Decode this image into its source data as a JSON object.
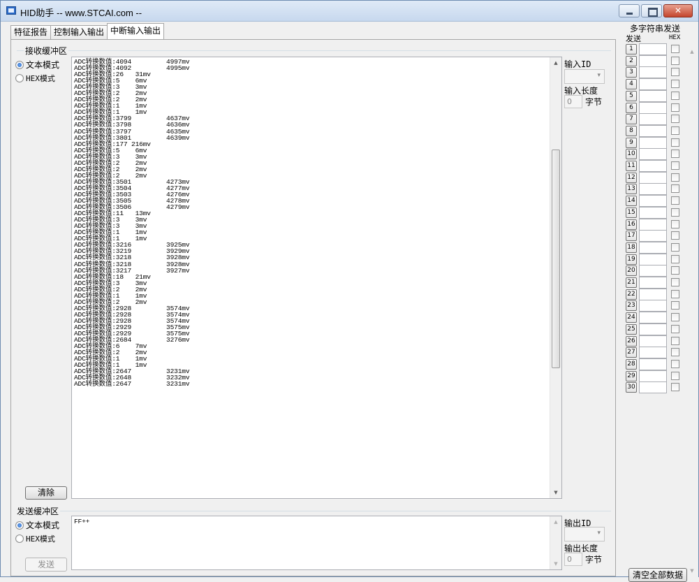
{
  "window": {
    "title": "HID助手 -- www.STCAI.com --"
  },
  "tabs": [
    {
      "label": "特征报告"
    },
    {
      "label": "控制输入输出"
    },
    {
      "label": "中断输入输出"
    }
  ],
  "receive": {
    "group_label": "接收缓冲区",
    "mode_text": "文本模式",
    "mode_hex": "HEX模式",
    "clear_button": "清除",
    "lines": [
      "ADC转换数值:4094         4997mv",
      "ADC转换数值:4092         4995mv",
      "ADC转换数值:26   31mv",
      "ADC转换数值:5    6mv",
      "ADC转换数值:3    3mv",
      "ADC转换数值:2    2mv",
      "ADC转换数值:2    2mv",
      "ADC转换数值:1    1mv",
      "ADC转换数值:1    1mv",
      "ADC转换数值:3799         4637mv",
      "ADC转换数值:3798         4636mv",
      "ADC转换数值:3797         4635mv",
      "ADC转换数值:3801         4639mv",
      "ADC转换数值:177 216mv",
      "ADC转换数值:5    6mv",
      "ADC转换数值:3    3mv",
      "ADC转换数值:2    2mv",
      "ADC转换数值:2    2mv",
      "ADC转换数值:2    2mv",
      "ADC转换数值:3501         4273mv",
      "ADC转换数值:3504         4277mv",
      "ADC转换数值:3503         4276mv",
      "ADC转换数值:3505         4278mv",
      "ADC转换数值:3506         4279mv",
      "ADC转换数值:11   13mv",
      "ADC转换数值:3    3mv",
      "ADC转换数值:3    3mv",
      "ADC转换数值:1    1mv",
      "ADC转换数值:1    1mv",
      "ADC转换数值:3216         3925mv",
      "ADC转换数值:3219         3929mv",
      "ADC转换数值:3218         3928mv",
      "ADC转换数值:3218         3928mv",
      "ADC转换数值:3217         3927mv",
      "ADC转换数值:18   21mv",
      "ADC转换数值:3    3mv",
      "ADC转换数值:2    2mv",
      "ADC转换数值:1    1mv",
      "ADC转换数值:2    2mv",
      "ADC转换数值:2928         3574mv",
      "ADC转换数值:2928         3574mv",
      "ADC转换数值:2928         3574mv",
      "ADC转换数值:2929         3575mv",
      "ADC转换数值:2929         3575mv",
      "ADC转换数值:2684         3276mv",
      "ADC转换数值:6    7mv",
      "ADC转换数值:2    2mv",
      "ADC转换数值:1    1mv",
      "ADC转换数值:1    1mv",
      "ADC转换数值:2647         3231mv",
      "ADC转换数值:2648         3232mv",
      "ADC转换数值:2647         3231mv"
    ],
    "input_id_label": "输入ID",
    "input_length_label": "输入长度",
    "input_length_value": "0",
    "bytes_unit": "字节"
  },
  "send": {
    "group_label": "发送缓冲区",
    "mode_text": "文本模式",
    "mode_hex": "HEX模式",
    "content": "FF++",
    "send_button": "发送",
    "output_id_label": "输出ID",
    "output_length_label": "输出长度",
    "output_length_value": "0",
    "bytes_unit": "字节"
  },
  "multi_send": {
    "title": "多字符串发送",
    "col_send": "发送",
    "col_hex": "HEX",
    "rows": [
      "1",
      "2",
      "3",
      "4",
      "5",
      "6",
      "7",
      "8",
      "9",
      "10",
      "11",
      "12",
      "13",
      "14",
      "15",
      "16",
      "17",
      "18",
      "19",
      "20",
      "21",
      "22",
      "23",
      "24",
      "25",
      "26",
      "27",
      "28",
      "29",
      "30"
    ],
    "clear_all_button": "清空全部数据"
  }
}
